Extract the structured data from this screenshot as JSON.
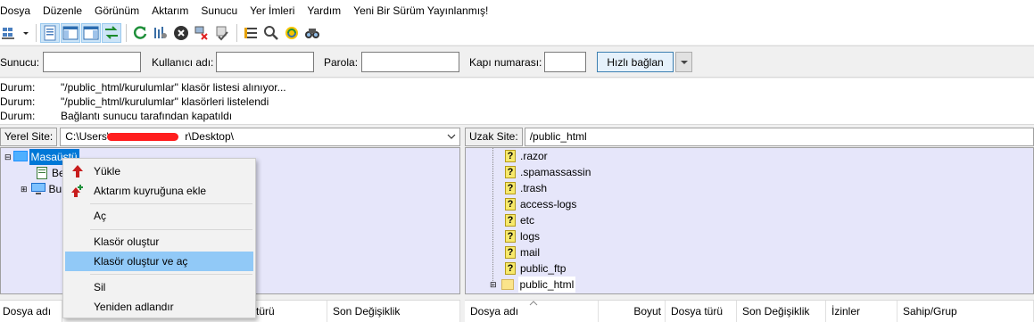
{
  "menu": [
    "Dosya",
    "Düzenle",
    "Görünüm",
    "Aktarım",
    "Sunucu",
    "Yer İmleri",
    "Yardım",
    "Yeni Bir Sürüm Yayınlanmış!"
  ],
  "toolbar": {
    "icons": [
      "site-manager-icon",
      "dropdown-arrow-icon",
      "toggle-log-icon",
      "toggle-local-tree-icon",
      "toggle-remote-tree-icon",
      "toggle-queue-icon",
      "refresh-icon",
      "process-queue-icon",
      "cancel-icon",
      "disconnect-icon",
      "reconnect-icon",
      "filter-icon",
      "compare-icon",
      "sync-browse-icon",
      "search-icon"
    ]
  },
  "quickconnect": {
    "host_label": "Sunucu:",
    "host_value": "",
    "user_label": "Kullanıcı adı:",
    "user_value": "",
    "pass_label": "Parola:",
    "pass_value": "",
    "port_label": "Kapı numarası:",
    "port_value": "",
    "connect_label": "Hızlı bağlan"
  },
  "log": [
    {
      "type": "Durum:",
      "message": "\"/public_html/kurulumlar\" klasör listesi alınıyor..."
    },
    {
      "type": "Durum:",
      "message": "\"/public_html/kurulumlar\" klasörleri listelendi"
    },
    {
      "type": "Durum:",
      "message": "Bağlantı sunucu tarafından kapatıldı"
    }
  ],
  "local": {
    "label": "Yerel Site:",
    "path_prefix": "C:\\Users\\",
    "path_suffix": "r\\Desktop\\",
    "tree": [
      "Masaüstü",
      "Be",
      "Bu"
    ],
    "columns": [
      "Dosya adı",
      "türü",
      "Son Değişiklik"
    ]
  },
  "remote": {
    "label": "Uzak Site:",
    "path": "/public_html",
    "tree": [
      ".razor",
      ".spamassassin",
      ".trash",
      "access-logs",
      "etc",
      "logs",
      "mail",
      "public_ftp",
      "public_html"
    ],
    "columns": [
      "Dosya adı",
      "Boyut",
      "Dosya türü",
      "Son Değişiklik",
      "İzinler",
      "Sahip/Grup"
    ]
  },
  "context_menu": {
    "items": [
      "Yükle",
      "Aktarım kuyruğuna ekle",
      "Aç",
      "Klasör oluştur",
      "Klasör oluştur ve aç",
      "Sil",
      "Yeniden adlandır"
    ],
    "highlighted": "Klasör oluştur ve aç"
  },
  "colors": {
    "tree_bg": "#e6e6fa",
    "menu_highlight": "#91c9f7",
    "redaction": "#ff1f1f"
  }
}
